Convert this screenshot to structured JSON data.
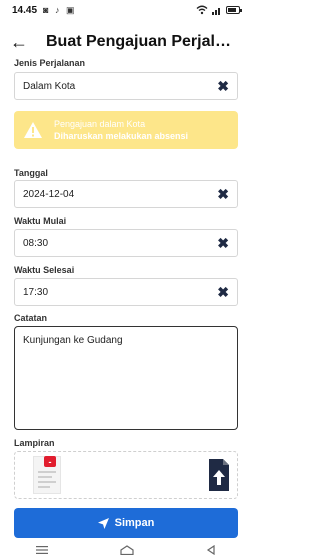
{
  "status": {
    "time": "14.45",
    "icons": "◙ ♪ ▣"
  },
  "header": {
    "title": "Buat Pengajuan Perjalanan"
  },
  "form": {
    "jenis_label": "Jenis Perjalanan",
    "jenis_value": "Dalam Kota",
    "alert_line1": "Pengajuan dalam Kota",
    "alert_line2": "Diharuskan melakukan absensi",
    "tanggal_label": "Tanggal",
    "tanggal_value": "2024-12-04",
    "waktu_mulai_label": "Waktu Mulai",
    "waktu_mulai_value": "08:30",
    "waktu_selesai_label": "Waktu Selesai",
    "waktu_selesai_value": "17:30",
    "catatan_label": "Catatan",
    "catatan_value": "Kunjungan ke Gudang",
    "lampiran_label": "Lampiran",
    "remove_glyph": "-"
  },
  "actions": {
    "submit_label": "Simpan"
  },
  "colors": {
    "accent": "#1e6cd8",
    "alert_bg": "#fde68a",
    "remove": "#e11d2e"
  }
}
